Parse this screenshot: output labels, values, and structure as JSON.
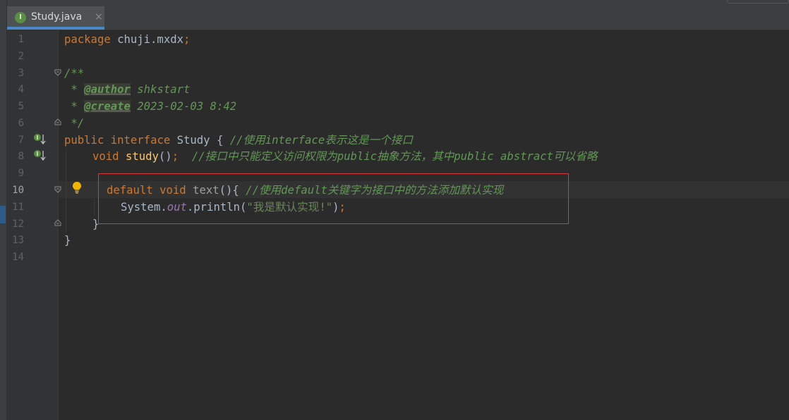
{
  "tab": {
    "filename": "Study.java",
    "icon": "I",
    "close": "×"
  },
  "lines": {
    "numbers": [
      "1",
      "2",
      "3",
      "4",
      "5",
      "6",
      "7",
      "8",
      "9",
      "10",
      "11",
      "12",
      "13",
      "14"
    ],
    "current": "10"
  },
  "code": {
    "l1_kw": "package",
    "l1_rest": " chuji.mxdx",
    "l1_semi": ";",
    "l3": "/**",
    "l4_star": " * ",
    "l4_tag": "@author",
    "l4_val": " shkstart",
    "l5_star": " * ",
    "l5_tag": "@create",
    "l5_val": " 2023-02-03 8:42",
    "l6": " */",
    "l7_kw1": "public",
    "l7_kw2": "interface",
    "l7_name": "Study",
    "l7_brace": " { ",
    "l7_cmt": "//使用interface表示这是一个接口",
    "l8_kw": "void",
    "l8_fn": "study",
    "l8_paren": "()",
    "l8_semi": ";",
    "l8_cmt": "//接口中只能定义访问权限为public抽象方法，其中public abstract可以省略",
    "l10_kw1": "default",
    "l10_kw2": "void",
    "l10_fn": "text",
    "l10_paren": "(){ ",
    "l10_cmt": "//使用default关键字为接口中的方法添加默认实现",
    "l11_cls": "System.",
    "l11_field": "out",
    "l11_call": ".println(",
    "l11_str": "\"我是默认实现!\"",
    "l11_close": ")",
    "l11_semi": ";",
    "l12": "}",
    "l13": "}"
  },
  "colors": {
    "background": "#2b2b2b",
    "keyword": "#cc7832",
    "comment": "#629755",
    "string": "#6a8759",
    "annotation_box": "#d63a3a",
    "tab_underline": "#4a88c7"
  }
}
